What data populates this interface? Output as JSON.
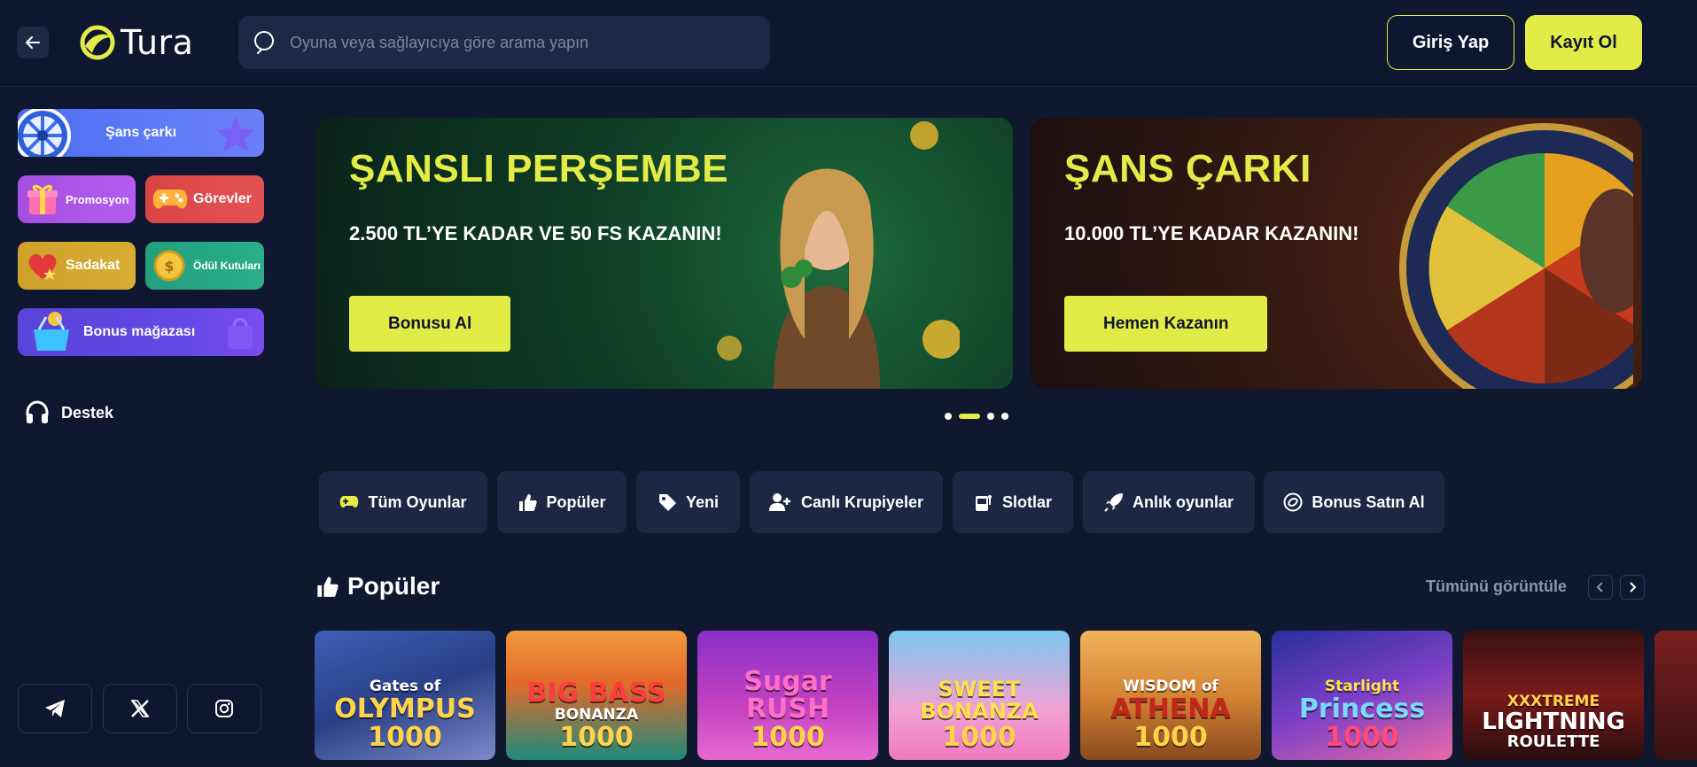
{
  "header": {
    "logo_text": "Tura",
    "search_placeholder": "Oyuna veya sağlayıcıya göre arama yapın",
    "login_label": "Giriş Yap",
    "register_label": "Kayıt Ol"
  },
  "sidebar": {
    "wheel_label": "Şans çarkı",
    "promo_label": "Promosyon",
    "tasks_label": "Görevler",
    "loyalty_label": "Sadakat",
    "boxes_label": "Ödül Kutuları",
    "shop_label": "Bonus mağazası",
    "support_label": "Destek",
    "socials": [
      "telegram-icon",
      "x-icon",
      "instagram-icon"
    ]
  },
  "banners": [
    {
      "title": "ŞANSLI PERŞEMBE",
      "subtitle": "2.500 TL’YE KADAR VE 50 FS KAZANIN!",
      "button": "Bonusu Al"
    },
    {
      "title": "ŞANS ÇARKI",
      "subtitle": "10.000 TL’YE KADAR KAZANIN!",
      "button": "Hemen Kazanın"
    }
  ],
  "carousel": {
    "dots": 4,
    "active": 2
  },
  "tabs": [
    "Tüm Oyunlar",
    "Popüler",
    "Yeni",
    "Canlı Krupiyeler",
    "Slotlar",
    "Anlık oyunlar",
    "Bonus Satın Al"
  ],
  "section": {
    "title": "Popüler",
    "see_all": "Tümünü görüntüle"
  },
  "games": [
    {
      "line1": "Gates of",
      "line2": "OLYMPUS",
      "line3": "1000"
    },
    {
      "line1": "BIG BASS",
      "line2": "BONANZA",
      "line3": "1000"
    },
    {
      "line1": "",
      "line2": "Sugar RUSH",
      "line3": "1000"
    },
    {
      "line1": "",
      "line2": "SWEET BONANZA",
      "line3": "1000"
    },
    {
      "line1": "WISDOM of",
      "line2": "ATHENA",
      "line3": "1000"
    },
    {
      "line1": "Starlight",
      "line2": "Princess",
      "line3": "1000"
    },
    {
      "line1": "XXXTREME",
      "line2": "LIGHTNING",
      "line3": "ROULETTE"
    }
  ],
  "colors": {
    "accent": "#e3ec46",
    "background": "#101830",
    "header": "#0e1630",
    "tab_bg": "#1d2744"
  }
}
